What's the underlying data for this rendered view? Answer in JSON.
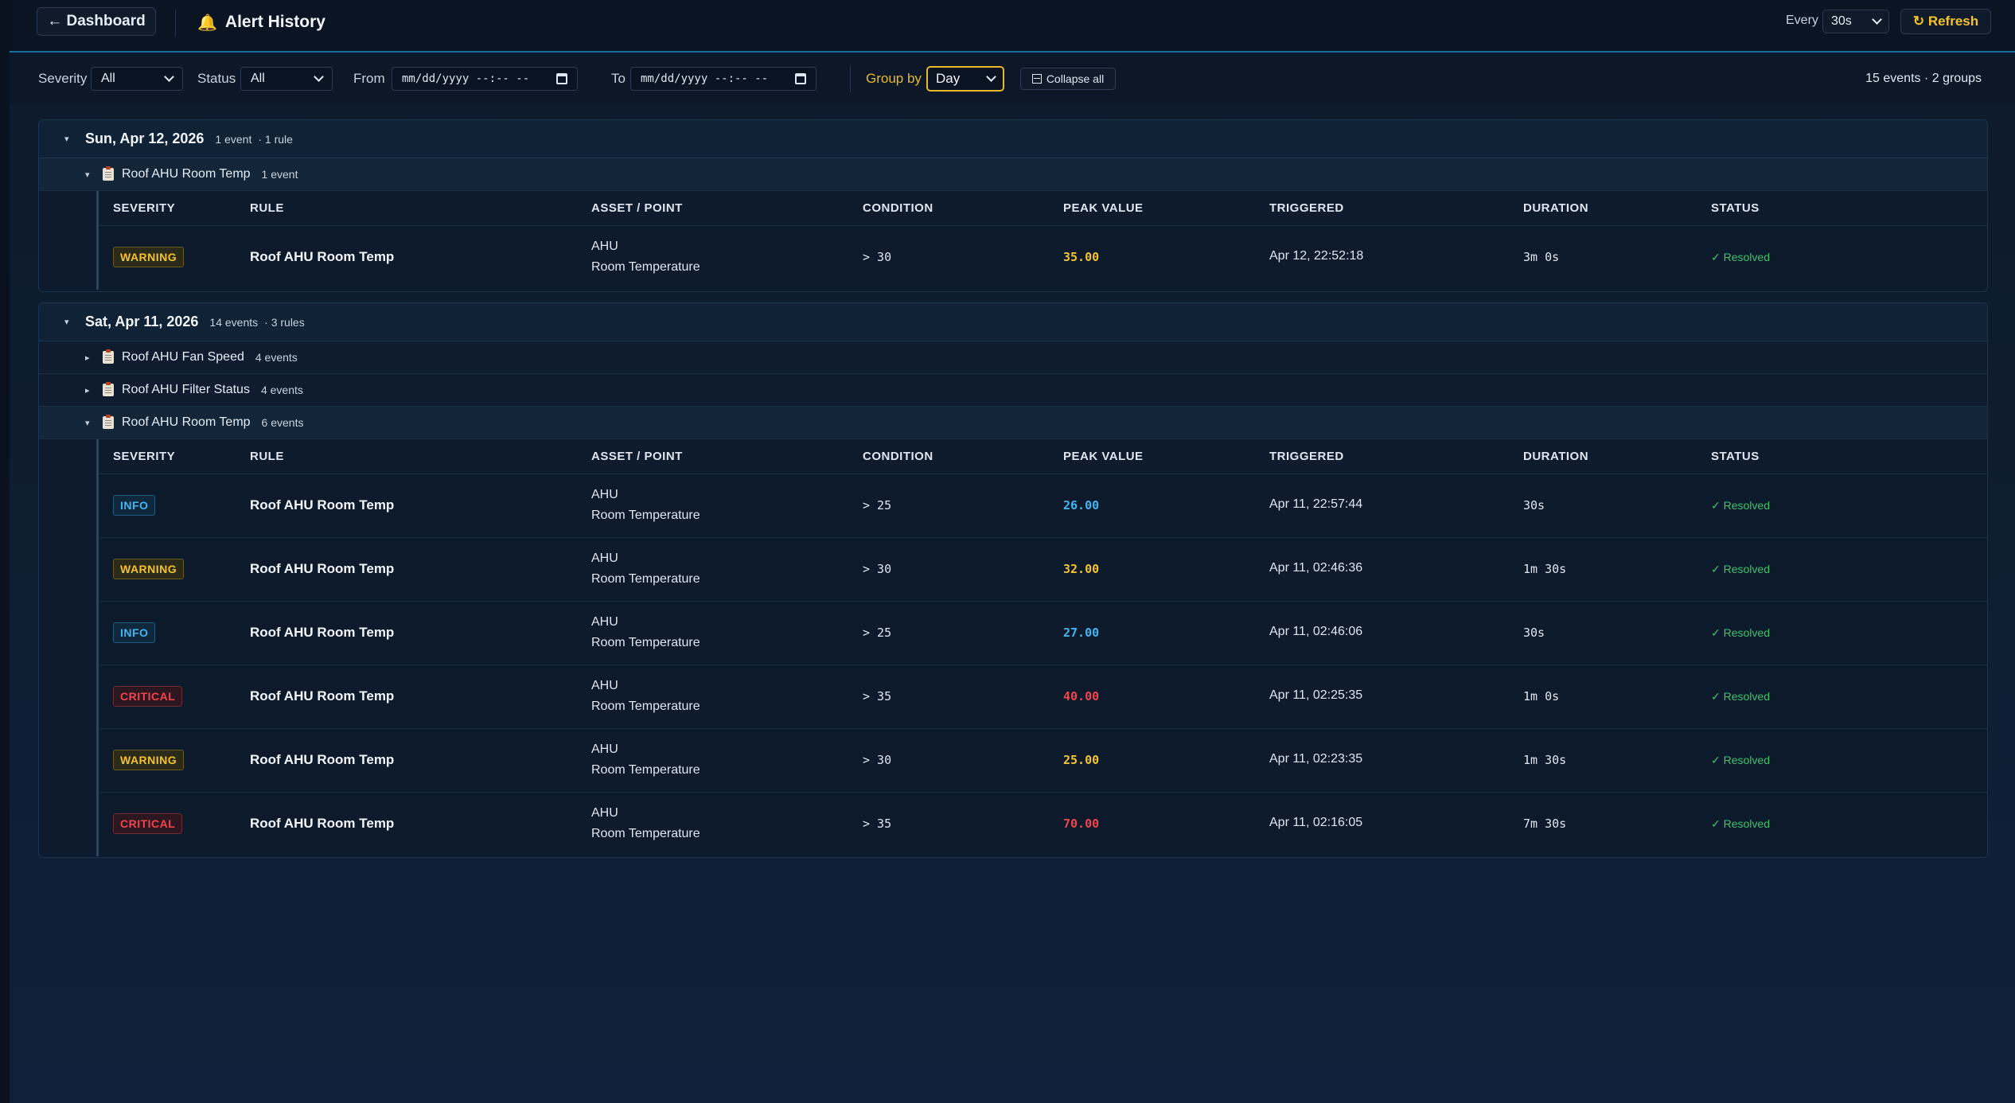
{
  "header": {
    "back_label": "← Dashboard",
    "title": "Alert History",
    "every_label": "Every",
    "every_value": "30s",
    "refresh_label": "↻ Refresh"
  },
  "filters": {
    "severity_label": "Severity",
    "severity_value": "All",
    "status_label": "Status",
    "status_value": "All",
    "from_label": "From",
    "from_placeholder": "mm/dd/yyyy  --:-- --",
    "to_label": "To",
    "to_placeholder": "mm/dd/yyyy  --:-- --",
    "groupby_label": "Group by",
    "groupby_value": "Day",
    "collapse_label": "Collapse all",
    "summary": "15 events · 2 groups"
  },
  "columns": {
    "severity": "SEVERITY",
    "rule": "RULE",
    "asset": "ASSET / POINT",
    "condition": "CONDITION",
    "peak": "PEAK VALUE",
    "triggered": "TRIGGERED",
    "duration": "DURATION",
    "status": "STATUS"
  },
  "colors": {
    "warning": "#f5c32b",
    "info": "#3fb6f5",
    "critical": "#f0454b",
    "resolved": "#3ec46d",
    "accent": "#e8b92a"
  },
  "groups": [
    {
      "date": "Sun, Apr 12, 2026",
      "events": "1 event",
      "rules": "· 1 rule",
      "subgroups": [
        {
          "name": "Roof AHU Room Temp",
          "count": "1 event",
          "open": true
        }
      ],
      "rows": [
        {
          "severity": "WARNING",
          "level": "warning",
          "rule": "Roof AHU Room Temp",
          "asset": "AHU",
          "point": "Room Temperature",
          "condition": "> 30",
          "peak": "35.00",
          "triggered": "Apr 12, 22:52:18",
          "duration": "3m 0s",
          "status": "✓ Resolved"
        }
      ]
    },
    {
      "date": "Sat, Apr 11, 2026",
      "events": "14 events",
      "rules": "· 3 rules",
      "subgroups": [
        {
          "name": "Roof AHU Fan Speed",
          "count": "4 events",
          "open": false
        },
        {
          "name": "Roof AHU Filter Status",
          "count": "4 events",
          "open": false
        },
        {
          "name": "Roof AHU Room Temp",
          "count": "6 events",
          "open": true
        }
      ],
      "rows": [
        {
          "severity": "INFO",
          "level": "info",
          "rule": "Roof AHU Room Temp",
          "asset": "AHU",
          "point": "Room Temperature",
          "condition": "> 25",
          "peak": "26.00",
          "triggered": "Apr 11, 22:57:44",
          "duration": "30s",
          "status": "✓ Resolved"
        },
        {
          "severity": "WARNING",
          "level": "warning",
          "rule": "Roof AHU Room Temp",
          "asset": "AHU",
          "point": "Room Temperature",
          "condition": "> 30",
          "peak": "32.00",
          "triggered": "Apr 11, 02:46:36",
          "duration": "1m 30s",
          "status": "✓ Resolved"
        },
        {
          "severity": "INFO",
          "level": "info",
          "rule": "Roof AHU Room Temp",
          "asset": "AHU",
          "point": "Room Temperature",
          "condition": "> 25",
          "peak": "27.00",
          "triggered": "Apr 11, 02:46:06",
          "duration": "30s",
          "status": "✓ Resolved"
        },
        {
          "severity": "CRITICAL",
          "level": "critical",
          "rule": "Roof AHU Room Temp",
          "asset": "AHU",
          "point": "Room Temperature",
          "condition": "> 35",
          "peak": "40.00",
          "triggered": "Apr 11, 02:25:35",
          "duration": "1m 0s",
          "status": "✓ Resolved"
        },
        {
          "severity": "WARNING",
          "level": "warning",
          "rule": "Roof AHU Room Temp",
          "asset": "AHU",
          "point": "Room Temperature",
          "condition": "> 30",
          "peak": "25.00",
          "triggered": "Apr 11, 02:23:35",
          "duration": "1m 30s",
          "status": "✓ Resolved"
        },
        {
          "severity": "CRITICAL",
          "level": "critical",
          "rule": "Roof AHU Room Temp",
          "asset": "AHU",
          "point": "Room Temperature",
          "condition": "> 35",
          "peak": "70.00",
          "triggered": "Apr 11, 02:16:05",
          "duration": "7m 30s",
          "status": "✓ Resolved"
        }
      ]
    }
  ]
}
